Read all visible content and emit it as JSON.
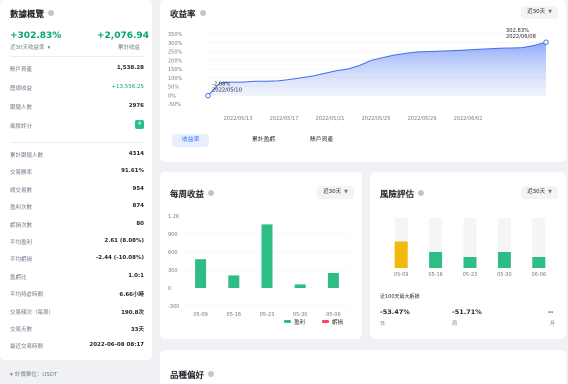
{
  "left": {
    "title": "數據概覽",
    "pnl_pct": "+302.83%",
    "pnl_amt": "+2,076.94",
    "range_label": "近30天收益率",
    "cum_label": "累計收益",
    "rows1": [
      {
        "label": "賬戶資產",
        "value": "1,538.28"
      },
      {
        "label": "歷總收益",
        "value": "+13,556.25"
      },
      {
        "label": "跟隨人數",
        "value": "2976"
      },
      {
        "label": "風險評分",
        "value": "4"
      }
    ],
    "rows2": [
      {
        "label": "累計跟隨人數",
        "value": "4314"
      },
      {
        "label": "交易勝率",
        "value": "91.61%"
      },
      {
        "label": "總交易數",
        "value": "954"
      },
      {
        "label": "盈利次數",
        "value": "874"
      },
      {
        "label": "虧損次數",
        "value": "80"
      },
      {
        "label": "平均盈利",
        "value": "2.61 (8.08%)"
      },
      {
        "label": "平均虧損",
        "value": "-2.44 (-10.08%)"
      },
      {
        "label": "盈虧比",
        "value": "1.0:1"
      },
      {
        "label": "平均持倉時間",
        "value": "6.66小時"
      },
      {
        "label": "交易頻次（每周）",
        "value": "190.8次"
      },
      {
        "label": "交易天數",
        "value": "33天"
      },
      {
        "label": "最近交易時間",
        "value": "2022-06-08 08:17"
      }
    ],
    "footnote": "計價單位：USDT"
  },
  "returns": {
    "title": "收益率",
    "range": "近30天",
    "tabs": [
      "收益率",
      "累計盈虧",
      "賬戶資產"
    ],
    "start_tip": {
      "value": "-2.08%",
      "date": "2022/05/10"
    },
    "end_tip": {
      "value": "302.83%",
      "date": "2022/06/08"
    }
  },
  "weekly": {
    "title": "每周收益",
    "range": "近30天",
    "legend_profit": "盈利",
    "legend_loss": "虧損",
    "profit_color": "#2ebd85",
    "loss_color": "#f6465d"
  },
  "risk": {
    "title": "風險評估",
    "range": "近30天",
    "caption": "近100天最大虧損",
    "stats": [
      {
        "value": "-53.47%",
        "label": "日"
      },
      {
        "value": "-51.71%",
        "label": "周"
      },
      {
        "value": "--",
        "label": "月"
      }
    ]
  },
  "pref": {
    "title": "品種偏好"
  },
  "chart_data": [
    {
      "type": "area",
      "title": "收益率",
      "x_ticks": [
        "2022/05/13",
        "2022/05/17",
        "2022/05/21",
        "2022/05/25",
        "2022/05/29",
        "2022/06/02"
      ],
      "y_ticks": [
        "350%",
        "300%",
        "250%",
        "200%",
        "150%",
        "100%",
        "50%",
        "0%",
        "-50%"
      ],
      "ylim": [
        -50,
        350
      ],
      "x": [
        "05/10",
        "05/11",
        "05/12",
        "05/13",
        "05/14",
        "05/15",
        "05/16",
        "05/17",
        "05/18",
        "05/19",
        "05/20",
        "05/21",
        "05/22",
        "05/23",
        "05/24",
        "05/25",
        "05/26",
        "05/27",
        "05/28",
        "05/29",
        "05/30",
        "05/31",
        "06/01",
        "06/02",
        "06/03",
        "06/04",
        "06/05",
        "06/06",
        "06/07",
        "06/08"
      ],
      "values": [
        -2,
        70,
        75,
        75,
        80,
        80,
        82,
        90,
        100,
        110,
        125,
        140,
        150,
        170,
        200,
        215,
        230,
        240,
        248,
        250,
        252,
        255,
        258,
        262,
        265,
        268,
        270,
        272,
        285,
        303
      ]
    },
    {
      "type": "bar",
      "title": "每周收益",
      "categories": [
        "05-09",
        "05-16",
        "05-23",
        "05-30",
        "05-06"
      ],
      "y_ticks": [
        "1.2K",
        "900",
        "600",
        "300",
        "0",
        "-300"
      ],
      "ylim": [
        -300,
        1200
      ],
      "series": [
        {
          "name": "盈利",
          "values": [
            480,
            210,
            1060,
            60,
            250
          ]
        },
        {
          "name": "虧損",
          "values": [
            0,
            0,
            0,
            0,
            0
          ]
        }
      ]
    },
    {
      "type": "bar",
      "title": "風險評估",
      "categories": [
        "05-09",
        "05-16",
        "05-23",
        "05-30",
        "06-06"
      ],
      "values": [
        0.53,
        0.32,
        0.22,
        0.32,
        0.22
      ],
      "bar_colors": [
        "#f0b90b",
        "#2ebd85",
        "#2ebd85",
        "#2ebd85",
        "#2ebd85"
      ]
    }
  ]
}
